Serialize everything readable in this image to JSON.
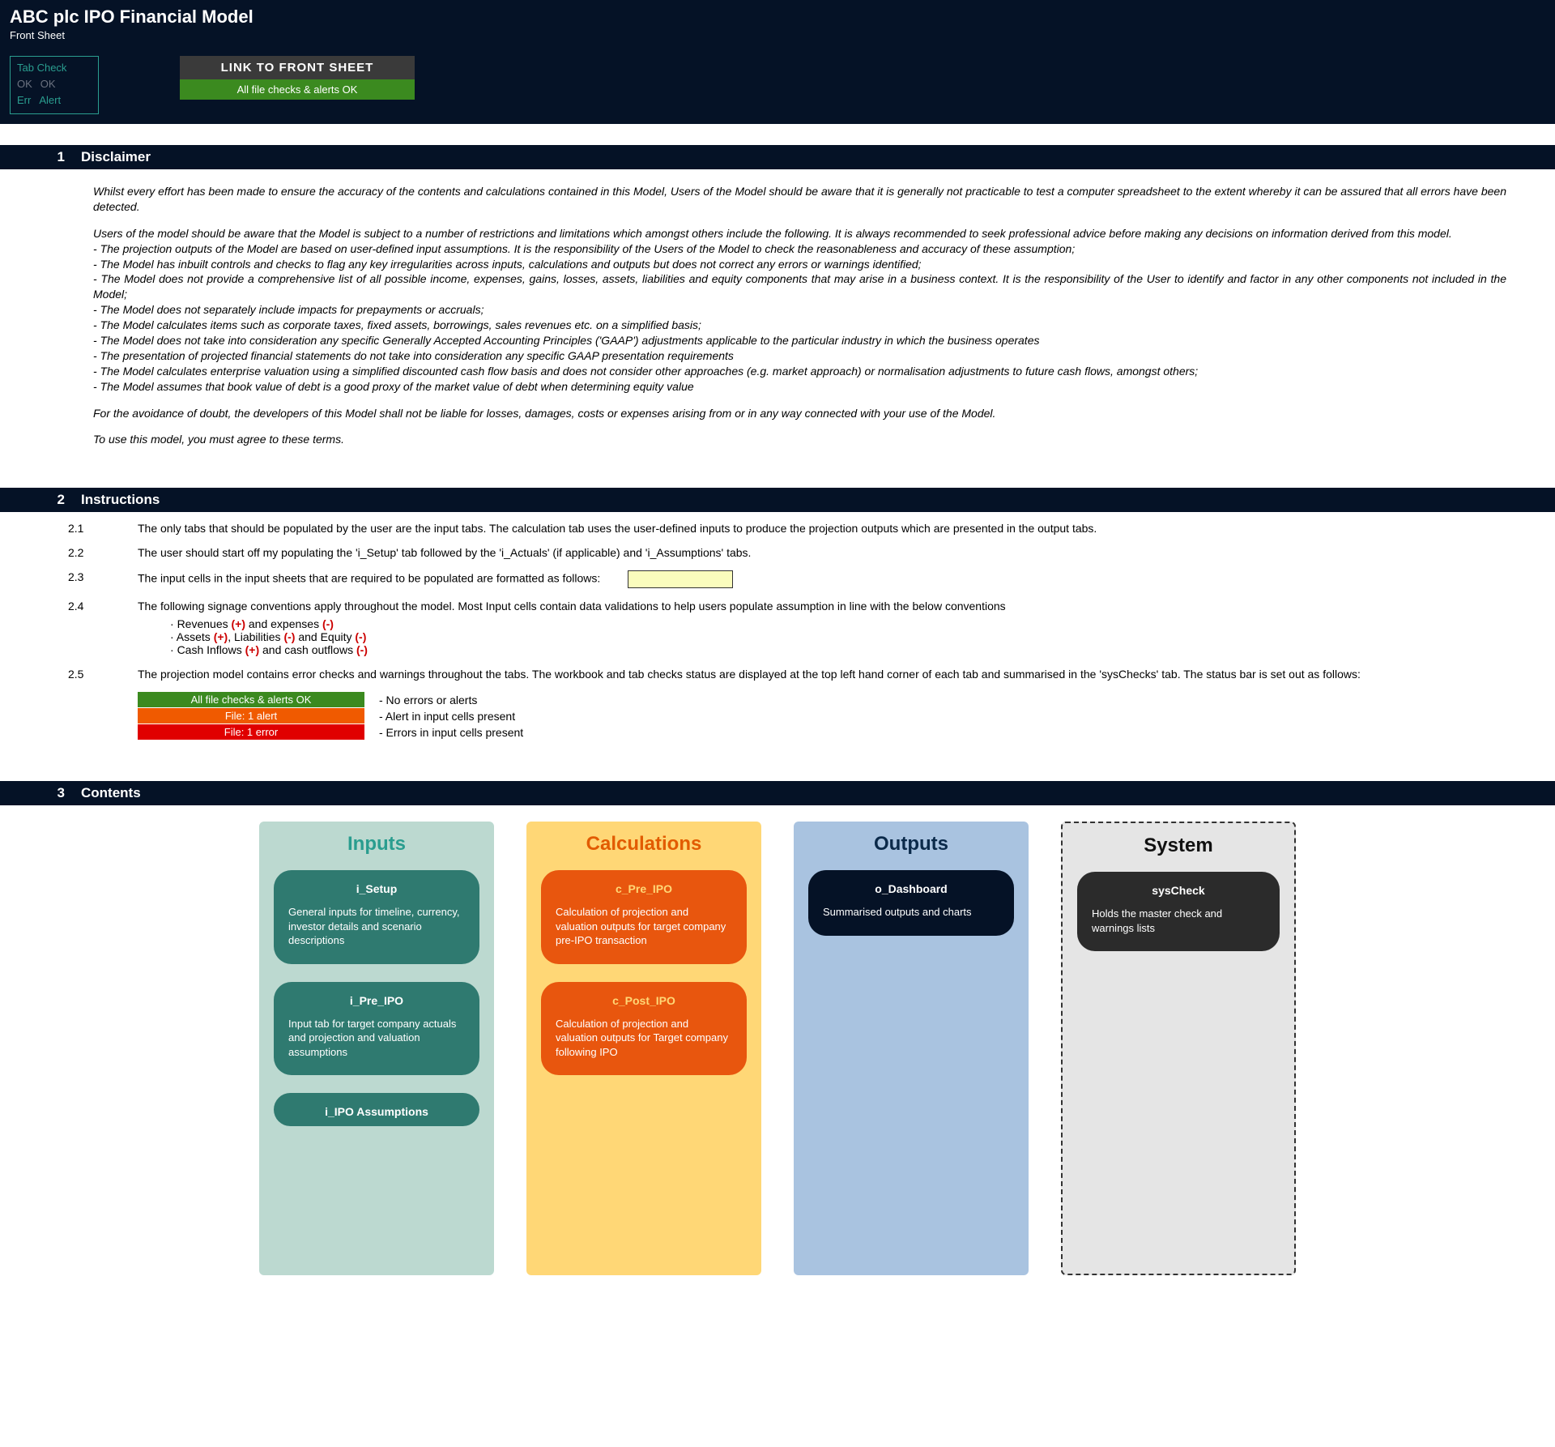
{
  "header": {
    "title": "ABC plc IPO Financial Model",
    "subtitle": "Front Sheet",
    "tabcheck": {
      "title": "Tab Check",
      "ok1": "OK",
      "ok2": "OK",
      "err": "Err",
      "alert": "Alert"
    },
    "linkbox": {
      "top": "LINK TO FRONT SHEET",
      "bot": "All file checks & alerts OK"
    }
  },
  "sections": {
    "s1": {
      "num": "1",
      "name": "Disclaimer"
    },
    "s2": {
      "num": "2",
      "name": "Instructions"
    },
    "s3": {
      "num": "3",
      "name": "Contents"
    }
  },
  "disclaimer": {
    "p1": "Whilst every effort has been made to ensure the accuracy of the contents and calculations contained in this Model, Users of the Model should be aware that it is generally not practicable to test a computer spreadsheet to the extent whereby it can be assured that all errors have been detected.",
    "p2": "Users of the model should be aware that the Model is subject to a number of restrictions and limitations which amongst others include the following. It is always recommended to seek professional advice before making any decisions on information derived from this model.",
    "b1": "- The projection outputs of the Model are based on user-defined input assumptions. It is the responsibility of the Users of the Model to check the reasonableness and accuracy of these assumption;",
    "b2": "- The Model has inbuilt controls and checks to flag any key irregularities across inputs, calculations and outputs but does not correct any errors or warnings identified;",
    "b3": "- The Model does not provide a comprehensive list of all possible income, expenses, gains, losses, assets, liabilities and equity components that may arise in a business context. It is the responsibility of the User to identify and factor in any other components not included in the Model;",
    "b4": "- The Model does not separately include impacts for prepayments or accruals;",
    "b5": "- The Model calculates items such as corporate taxes, fixed assets, borrowings, sales revenues etc. on a simplified basis;",
    "b6": "- The Model does not take into consideration any specific Generally Accepted Accounting Principles ('GAAP') adjustments applicable to the particular industry in which the business operates",
    "b7": "- The presentation of projected financial statements do not take into consideration any specific GAAP presentation requirements",
    "b8": "- The Model calculates enterprise valuation using a simplified discounted cash flow basis and does not consider other approaches (e.g. market approach) or normalisation adjustments to future cash flows, amongst others;",
    "b9": "- The Model assumes that book value of debt is a good proxy of the market value of debt when determining equity value",
    "p3": "For the avoidance of doubt, the developers of this Model shall not be liable for losses, damages, costs or expenses arising from or in any way connected with your use of the Model.",
    "p4": "To use this model, you must agree to these terms."
  },
  "instructions": {
    "r1": {
      "n": "2.1",
      "t": "The only tabs that should be populated by the user are the input tabs. The calculation tab uses the user-defined inputs to produce the projection outputs which are presented in the output tabs."
    },
    "r2": {
      "n": "2.2",
      "t": "The user should start off my populating the 'i_Setup' tab followed by the 'i_Actuals' (if applicable) and 'i_Assumptions' tabs."
    },
    "r3": {
      "n": "2.3",
      "t": "The input cells in the input sheets that are required to be populated are formatted as follows:"
    },
    "r4": {
      "n": "2.4",
      "t": "The following signage conventions apply throughout the model. Most Input cells contain data validations to help users populate assumption in line with the below conventions"
    },
    "r4b": {
      "a_pre": "Revenues ",
      "a_p": "(+)",
      "a_mid": " and expenses ",
      "a_m": "(-)",
      "b_pre": "Assets ",
      "b_p": "(+)",
      "b_mid": ", Liabilities ",
      "b_m1": "(-)",
      "b_mid2": " and Equity ",
      "b_m2": "(-)",
      "c_pre": "Cash Inflows ",
      "c_p": "(+)",
      "c_mid": " and cash outflows ",
      "c_m": "(-)"
    },
    "r5": {
      "n": "2.5",
      "t": "The projection model contains error checks and warnings throughout the tabs. The workbook and tab checks status are displayed at the top left hand corner of each tab and summarised in the 'sysChecks' tab. The status bar is set out as follows:"
    },
    "status": {
      "g": "All file checks & alerts OK",
      "gl": "- No errors or alerts",
      "o": "File: 1 alert",
      "ol": "- Alert in input cells present",
      "r": "File: 1 error",
      "rl": "- Errors in input cells present"
    }
  },
  "contents": {
    "inputs": {
      "title": "Inputs",
      "c1": {
        "name": "i_Setup",
        "desc": "General inputs for timeline, currency, investor details and scenario descriptions"
      },
      "c2": {
        "name": "i_Pre_IPO",
        "desc": "Input tab for target company actuals and projection and valuation assumptions"
      },
      "c3": {
        "name": "i_IPO Assumptions"
      }
    },
    "calcs": {
      "title": "Calculations",
      "c1": {
        "name": "c_Pre_IPO",
        "desc": "Calculation of projection and valuation outputs for target company pre-IPO transaction"
      },
      "c2": {
        "name": "c_Post_IPO",
        "desc": "Calculation of projection and valuation outputs for Target company following IPO"
      }
    },
    "outputs": {
      "title": "Outputs",
      "c1": {
        "name": "o_Dashboard",
        "desc": "Summarised outputs and charts"
      }
    },
    "system": {
      "title": "System",
      "c1": {
        "name": "sysCheck",
        "desc": "Holds the master check and warnings lists"
      }
    }
  }
}
